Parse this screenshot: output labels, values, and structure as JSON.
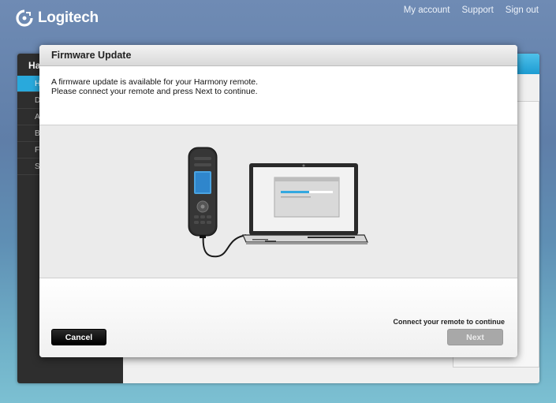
{
  "header": {
    "logo_text": "Logitech",
    "links": [
      "My account",
      "Support",
      "Sign out"
    ]
  },
  "background_app": {
    "title_partial": "Ha",
    "sidebar_items": [
      "H",
      "D",
      "A",
      "B",
      "F",
      "S"
    ],
    "active_item_index": 0
  },
  "dialog": {
    "title": "Firmware Update",
    "message_line1": "A firmware update is available for your Harmony remote.",
    "message_line2": "Please connect your remote and press Next to continue.",
    "status_text": "Connect your remote to continue",
    "cancel_label": "Cancel",
    "next_label": "Next",
    "next_enabled": false
  },
  "colors": {
    "accent_blue": "#29a9dc",
    "progress_bar": "#33a8e0",
    "button_dark": "#000000",
    "button_disabled": "#a8a8a8"
  }
}
